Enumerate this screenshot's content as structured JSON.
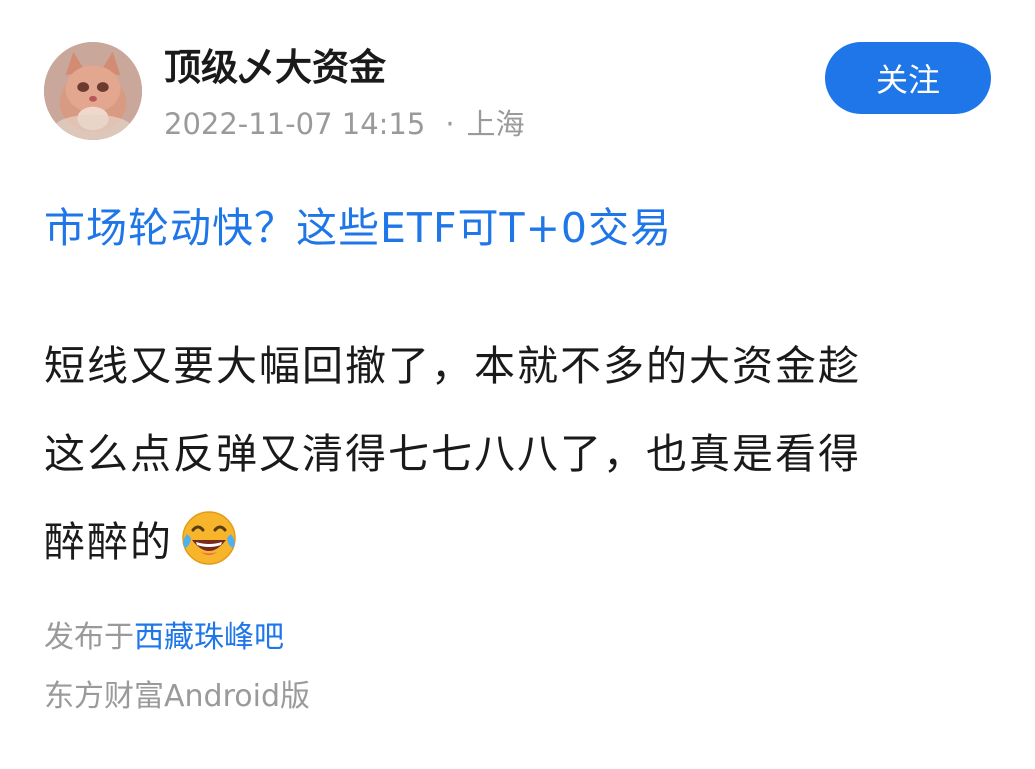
{
  "author": {
    "name": "顶级乄大资金",
    "avatar_icon": "cat-avatar-icon"
  },
  "post_meta": {
    "datetime": "2022-11-07 14:15",
    "separator": "·",
    "location": "上海"
  },
  "follow_button": {
    "label": "关注",
    "color": "#1f76e8"
  },
  "post": {
    "title": "市场轮动快？这些ETF可T+0交易",
    "body_lines": [
      "短线又要大幅回撤了，本就不多的大资金趁",
      "这么点反弹又清得七七八八了，也真是看得",
      "醉醉的"
    ],
    "body_emoji": "laughing-tears-emoji-icon"
  },
  "footer": {
    "published_prefix": "发布于",
    "forum_name": "西藏珠峰吧",
    "client": "东方财富Android版"
  },
  "colors": {
    "accent": "#1f76e8",
    "text": "#1a1a1a",
    "muted": "#9a9a9a"
  }
}
